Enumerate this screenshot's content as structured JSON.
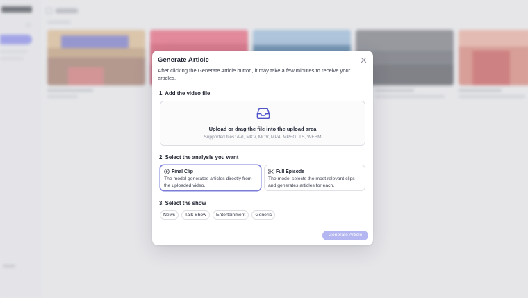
{
  "modal": {
    "title": "Generate Article",
    "description": "After clicking the Generate Article button, it may take a few minutes to receive your articles.",
    "close_icon": "close-icon"
  },
  "step1": {
    "title": "1. Add the video file",
    "upload_icon": "inbox-tray-icon",
    "upload_title": "Upload or drag the file into the upload area",
    "supported": "Supported files: AVI, MKV, MOV, MP4, MPEG, TS, WEBM"
  },
  "step2": {
    "title": "2. Select the analysis you want",
    "options": [
      {
        "icon": "play-circle-icon",
        "title": "Final Clip",
        "description": "The model generates articles directly from the uploaded video.",
        "selected": true
      },
      {
        "icon": "scissors-icon",
        "title": "Full Episode",
        "description": "The model selects the most relevant clips and generates articles for each.",
        "selected": false
      }
    ]
  },
  "step3": {
    "title": "3. Select the show",
    "chips": [
      "News",
      "Talk Show",
      "Entertainment",
      "Generic"
    ]
  },
  "actions": {
    "generate_label": "Generate Article"
  },
  "colors": {
    "accent": "#7a7ed8",
    "accent_icon": "#4f55c9",
    "button_disabled": "#b3b6f0",
    "sidebar_active": "#7e82e6"
  }
}
